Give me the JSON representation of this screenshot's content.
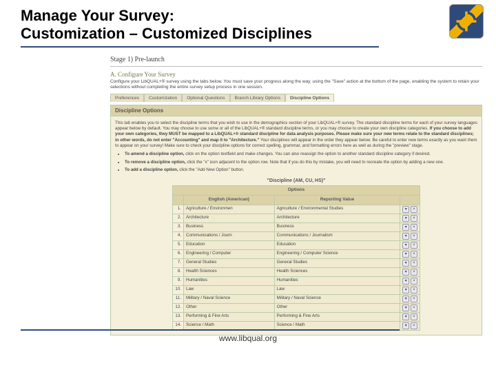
{
  "title_line1": "Manage Your Survey:",
  "title_line2": "Customization – Customized Disciplines",
  "footer_url": "www.libqual.org",
  "stage": "Stage 1) Pre-launch",
  "configure_head": "A. Configure Your Survey",
  "configure_intro": "Configure your LibQUAL+® survey using the tabs below. You must save your progress along the way, using the \"Save\" action at the bottom of the page, enabling the system to retain your selections without completing the entire survey setup process in one session.",
  "tabs": {
    "t0": "Preferences",
    "t1": "Customization",
    "t2": "Optional Questions",
    "t3": "Branch Library Options",
    "t4": "Discipline Options"
  },
  "panel_title": "Discipline Options",
  "panel_p1": "This tab enables you to select the discipline terms that you wish to use in the demographics section of your LibQUAL+® survey. The standard discipline terms for each of your survey languages appear below by default. You may choose to use some or all of the LibQUAL+® standard discipline terms, or you may choose to create your own discipline categories.",
  "panel_p1b": " If you choose to add your own categories, they MUST be mapped to a LibQUAL+® standard discipline for data analysis purposes. Please make sure your new terms relate to the standard disciplines; in other words, do not enter \"Accounting\" and map it to \"Architecture.\"",
  "panel_p1c": " Your disciplines will appear in the order they appear below. Be careful to enter new terms exactly as you want them to appear on your survey! Make sure to check your discipline options for correct spelling, grammar, and formatting errors here as well as during the \"preview\" stage.",
  "li1a": "To amend a discipline option,",
  "li1b": " click on the option textfield and make changes. You can also reassign the option to another standard discipline category if desired.",
  "li2a": "To remove a discipline option,",
  "li2b": " click the \"x\" icon adjacent to the option row. Note that if you do this by mistake, you will need to recreate the option by adding a new one.",
  "li3a": "To add a discipline option,",
  "li3b": " click the \"Add New Option\" button.",
  "table_caption": "\"Discipline (AM, CU, HS)\"",
  "col_opt": "Options",
  "col_eng": "English (American)",
  "col_rep": "Reporting Value",
  "rows": [
    {
      "n": "1.",
      "eng": "Agriculture / Environmen",
      "rep": "Agriculture / Environmental Studies"
    },
    {
      "n": "2.",
      "eng": "Architecture",
      "rep": "Architecture"
    },
    {
      "n": "3.",
      "eng": "Business",
      "rep": "Business"
    },
    {
      "n": "4.",
      "eng": "Communications / Journ",
      "rep": "Communications / Journalism"
    },
    {
      "n": "5.",
      "eng": "Education",
      "rep": "Education"
    },
    {
      "n": "6.",
      "eng": "Engineering / Computer",
      "rep": "Engineering / Computer Science"
    },
    {
      "n": "7.",
      "eng": "General Studies",
      "rep": "General Studies"
    },
    {
      "n": "8.",
      "eng": "Health Sciences",
      "rep": "Health Sciences"
    },
    {
      "n": "9.",
      "eng": "Humanities",
      "rep": "Humanities"
    },
    {
      "n": "10.",
      "eng": "Law",
      "rep": "Law"
    },
    {
      "n": "11.",
      "eng": "Military / Naval Science",
      "rep": "Military / Naval Science"
    },
    {
      "n": "12.",
      "eng": "Other",
      "rep": "Other"
    },
    {
      "n": "13.",
      "eng": "Performing & Fine Arts",
      "rep": "Performing & Fine Arts"
    },
    {
      "n": "14.",
      "eng": "Science / Math",
      "rep": "Science / Math"
    }
  ]
}
